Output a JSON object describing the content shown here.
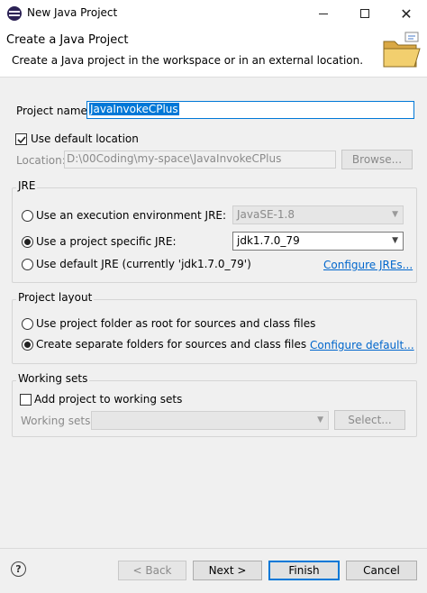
{
  "window": {
    "title": "New Java Project",
    "icon": "eclipse-icon"
  },
  "banner": {
    "title": "Create a Java Project",
    "description": "Create a Java project in the workspace or in an external location.",
    "icon": "folder-icon"
  },
  "project": {
    "name_label": "Project name:",
    "name_value": "JavaInvokeCPlus",
    "use_default_label": "Use default location",
    "use_default_checked": true,
    "location_label": "Location:",
    "location_value": "D:\\00Coding\\my-space\\JavaInvokeCPlus",
    "browse_label": "Browse..."
  },
  "jre": {
    "group_title": "JRE",
    "option_env_label": "Use an execution environment JRE:",
    "option_env_value": "JavaSE-1.8",
    "option_specific_label": "Use a project specific JRE:",
    "option_specific_value": "jdk1.7.0_79",
    "option_default_label": "Use default JRE (currently 'jdk1.7.0_79')",
    "configure_link": "Configure JREs...",
    "selected": "specific"
  },
  "layout": {
    "group_title": "Project layout",
    "option_root_label": "Use project folder as root for sources and class files",
    "option_separate_label": "Create separate folders for sources and class files",
    "configure_link": "Configure default...",
    "selected": "separate"
  },
  "working_sets": {
    "group_title": "Working sets",
    "add_label": "Add project to working sets",
    "add_checked": false,
    "sets_label": "Working sets:",
    "select_label": "Select..."
  },
  "footer": {
    "back_label": "< Back",
    "next_label": "Next >",
    "finish_label": "Finish",
    "cancel_label": "Cancel"
  },
  "colors": {
    "accent": "#0078d7",
    "link": "#0066cc"
  }
}
